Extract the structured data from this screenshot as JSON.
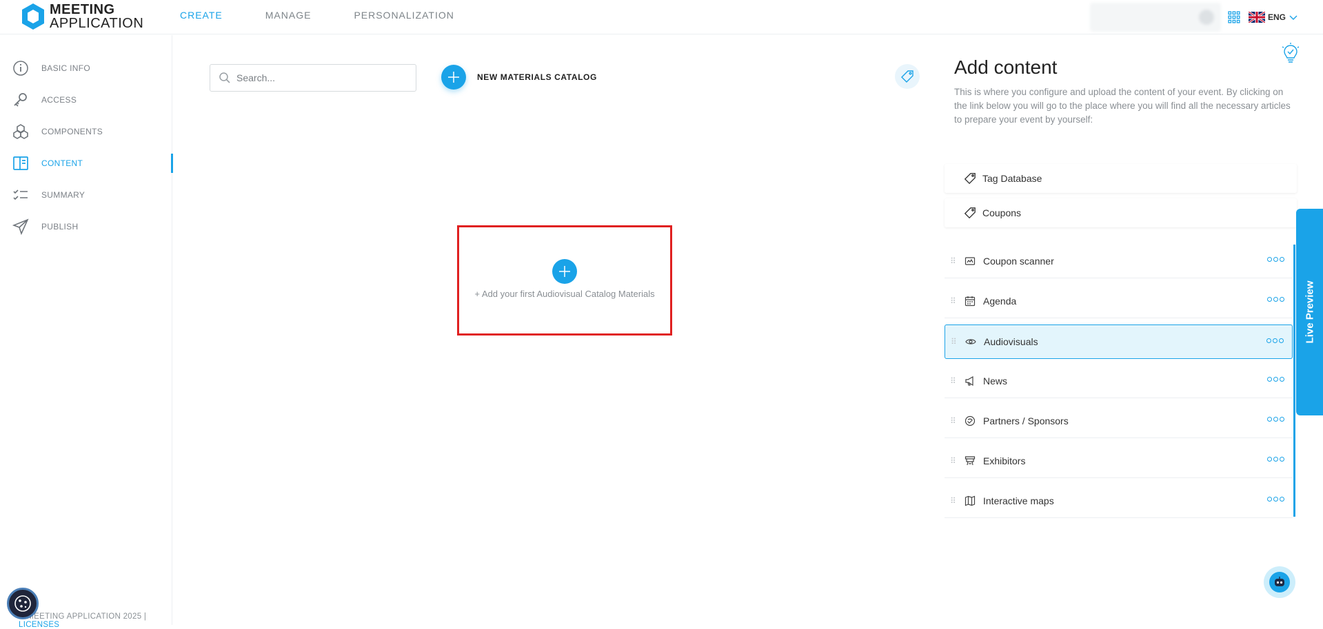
{
  "app": {
    "logo_line1": "MEETING",
    "logo_line2": "APPLICATION"
  },
  "topnav": {
    "items": [
      {
        "label": "CREATE",
        "active": true
      },
      {
        "label": "MANAGE",
        "active": false
      },
      {
        "label": "PERSONALIZATION",
        "active": false
      }
    ]
  },
  "topright": {
    "language": "ENG"
  },
  "sidebar": {
    "items": [
      {
        "label": "BASIC INFO",
        "icon": "info-icon"
      },
      {
        "label": "ACCESS",
        "icon": "key-icon"
      },
      {
        "label": "COMPONENTS",
        "icon": "components-icon"
      },
      {
        "label": "CONTENT",
        "icon": "content-icon",
        "active": true
      },
      {
        "label": "SUMMARY",
        "icon": "checklist-icon"
      },
      {
        "label": "PUBLISH",
        "icon": "send-icon"
      }
    ],
    "copyright": "© MEETING APPLICATION 2025 | ",
    "licenses": "LICENSES"
  },
  "main": {
    "search_placeholder": "Search...",
    "new_catalog_label": "NEW MATERIALS CATALOG",
    "empty_state_text": "+ Add your first Audiovisual Catalog Materials"
  },
  "right_panel": {
    "title": "Add content",
    "description": "This is where you configure and upload the content of your event. By clicking on the link below you will go to the place where you will find all the necessary articles to prepare your event by yourself:",
    "links": [
      {
        "label": "Tag Database",
        "icon": "tag-icon"
      },
      {
        "label": "Coupons",
        "icon": "tag-icon"
      }
    ],
    "components": [
      {
        "label": "Coupon scanner",
        "icon": "scanner-icon"
      },
      {
        "label": "Agenda",
        "icon": "calendar-icon"
      },
      {
        "label": "Audiovisuals",
        "icon": "eye-icon",
        "active": true
      },
      {
        "label": "News",
        "icon": "megaphone-icon"
      },
      {
        "label": "Partners / Sponsors",
        "icon": "partners-icon"
      },
      {
        "label": "Exhibitors",
        "icon": "booth-icon"
      },
      {
        "label": "Interactive maps",
        "icon": "map-icon"
      }
    ],
    "live_preview": "Live Preview"
  },
  "colors": {
    "accent": "#1aa3e8",
    "highlight_border": "#e02020",
    "active_row_bg": "#e3f5fc"
  }
}
